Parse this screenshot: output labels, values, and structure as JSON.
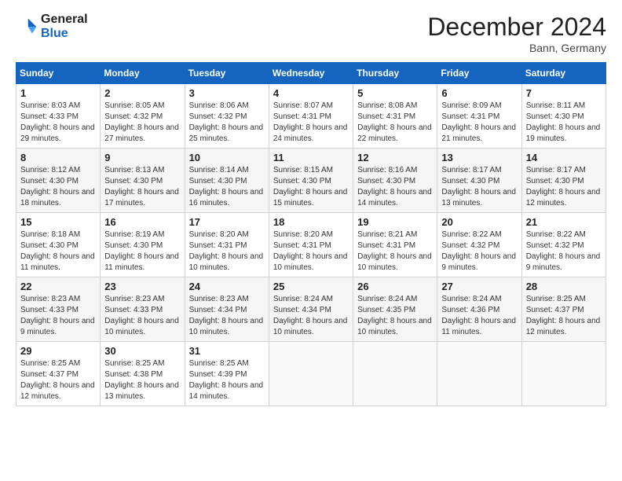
{
  "logo": {
    "line1": "General",
    "line2": "Blue"
  },
  "title": "December 2024",
  "subtitle": "Bann, Germany",
  "weekdays": [
    "Sunday",
    "Monday",
    "Tuesday",
    "Wednesday",
    "Thursday",
    "Friday",
    "Saturday"
  ],
  "weeks": [
    [
      {
        "day": "1",
        "sunrise": "8:03 AM",
        "sunset": "4:33 PM",
        "daylight": "8 hours and 29 minutes."
      },
      {
        "day": "2",
        "sunrise": "8:05 AM",
        "sunset": "4:32 PM",
        "daylight": "8 hours and 27 minutes."
      },
      {
        "day": "3",
        "sunrise": "8:06 AM",
        "sunset": "4:32 PM",
        "daylight": "8 hours and 25 minutes."
      },
      {
        "day": "4",
        "sunrise": "8:07 AM",
        "sunset": "4:31 PM",
        "daylight": "8 hours and 24 minutes."
      },
      {
        "day": "5",
        "sunrise": "8:08 AM",
        "sunset": "4:31 PM",
        "daylight": "8 hours and 22 minutes."
      },
      {
        "day": "6",
        "sunrise": "8:09 AM",
        "sunset": "4:31 PM",
        "daylight": "8 hours and 21 minutes."
      },
      {
        "day": "7",
        "sunrise": "8:11 AM",
        "sunset": "4:30 PM",
        "daylight": "8 hours and 19 minutes."
      }
    ],
    [
      {
        "day": "8",
        "sunrise": "8:12 AM",
        "sunset": "4:30 PM",
        "daylight": "8 hours and 18 minutes."
      },
      {
        "day": "9",
        "sunrise": "8:13 AM",
        "sunset": "4:30 PM",
        "daylight": "8 hours and 17 minutes."
      },
      {
        "day": "10",
        "sunrise": "8:14 AM",
        "sunset": "4:30 PM",
        "daylight": "8 hours and 16 minutes."
      },
      {
        "day": "11",
        "sunrise": "8:15 AM",
        "sunset": "4:30 PM",
        "daylight": "8 hours and 15 minutes."
      },
      {
        "day": "12",
        "sunrise": "8:16 AM",
        "sunset": "4:30 PM",
        "daylight": "8 hours and 14 minutes."
      },
      {
        "day": "13",
        "sunrise": "8:17 AM",
        "sunset": "4:30 PM",
        "daylight": "8 hours and 13 minutes."
      },
      {
        "day": "14",
        "sunrise": "8:17 AM",
        "sunset": "4:30 PM",
        "daylight": "8 hours and 12 minutes."
      }
    ],
    [
      {
        "day": "15",
        "sunrise": "8:18 AM",
        "sunset": "4:30 PM",
        "daylight": "8 hours and 11 minutes."
      },
      {
        "day": "16",
        "sunrise": "8:19 AM",
        "sunset": "4:30 PM",
        "daylight": "8 hours and 11 minutes."
      },
      {
        "day": "17",
        "sunrise": "8:20 AM",
        "sunset": "4:31 PM",
        "daylight": "8 hours and 10 minutes."
      },
      {
        "day": "18",
        "sunrise": "8:20 AM",
        "sunset": "4:31 PM",
        "daylight": "8 hours and 10 minutes."
      },
      {
        "day": "19",
        "sunrise": "8:21 AM",
        "sunset": "4:31 PM",
        "daylight": "8 hours and 10 minutes."
      },
      {
        "day": "20",
        "sunrise": "8:22 AM",
        "sunset": "4:32 PM",
        "daylight": "8 hours and 9 minutes."
      },
      {
        "day": "21",
        "sunrise": "8:22 AM",
        "sunset": "4:32 PM",
        "daylight": "8 hours and 9 minutes."
      }
    ],
    [
      {
        "day": "22",
        "sunrise": "8:23 AM",
        "sunset": "4:33 PM",
        "daylight": "8 hours and 9 minutes."
      },
      {
        "day": "23",
        "sunrise": "8:23 AM",
        "sunset": "4:33 PM",
        "daylight": "8 hours and 10 minutes."
      },
      {
        "day": "24",
        "sunrise": "8:23 AM",
        "sunset": "4:34 PM",
        "daylight": "8 hours and 10 minutes."
      },
      {
        "day": "25",
        "sunrise": "8:24 AM",
        "sunset": "4:34 PM",
        "daylight": "8 hours and 10 minutes."
      },
      {
        "day": "26",
        "sunrise": "8:24 AM",
        "sunset": "4:35 PM",
        "daylight": "8 hours and 10 minutes."
      },
      {
        "day": "27",
        "sunrise": "8:24 AM",
        "sunset": "4:36 PM",
        "daylight": "8 hours and 11 minutes."
      },
      {
        "day": "28",
        "sunrise": "8:25 AM",
        "sunset": "4:37 PM",
        "daylight": "8 hours and 12 minutes."
      }
    ],
    [
      {
        "day": "29",
        "sunrise": "8:25 AM",
        "sunset": "4:37 PM",
        "daylight": "8 hours and 12 minutes."
      },
      {
        "day": "30",
        "sunrise": "8:25 AM",
        "sunset": "4:38 PM",
        "daylight": "8 hours and 13 minutes."
      },
      {
        "day": "31",
        "sunrise": "8:25 AM",
        "sunset": "4:39 PM",
        "daylight": "8 hours and 14 minutes."
      },
      null,
      null,
      null,
      null
    ]
  ],
  "labels": {
    "sunrise": "Sunrise:",
    "sunset": "Sunset:",
    "daylight": "Daylight:"
  }
}
